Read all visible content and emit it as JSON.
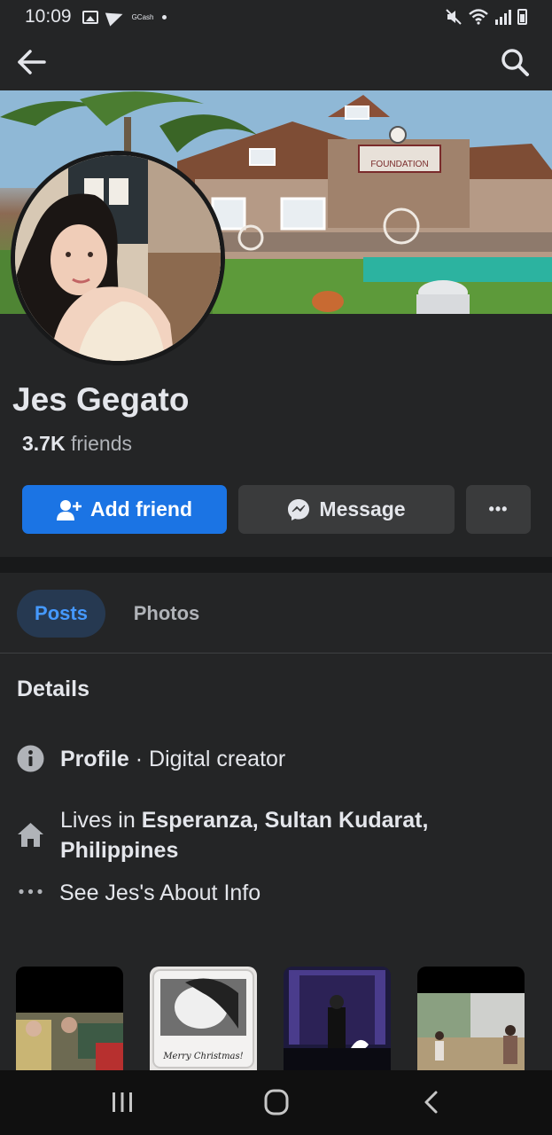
{
  "status_bar": {
    "time": "10:09",
    "gcash_label": "GCash"
  },
  "top_nav": {
    "back_icon": "arrow-left-icon",
    "search_icon": "search-icon"
  },
  "cover": {
    "sign_text": "FOUNDATION"
  },
  "profile": {
    "name": "Jes Gegato",
    "friends_count": "3.7K",
    "friends_label": "friends"
  },
  "actions": {
    "add_friend": "Add friend",
    "message": "Message",
    "more": "•••"
  },
  "tabs": [
    {
      "label": "Posts",
      "active": true
    },
    {
      "label": "Photos",
      "active": false
    }
  ],
  "details": {
    "title": "Details",
    "profile_label": "Profile",
    "profile_sep": " · ",
    "profile_value": "Digital creator",
    "lives_prefix": "Lives in ",
    "lives_location": "Esperanza, Sultan Kudarat, Philippines",
    "about_link": "See Jes's About Info"
  },
  "photos": {
    "thumb2_caption": "Merry Christmas!"
  },
  "colors": {
    "background": "#242526",
    "accent_blue": "#1b74e4",
    "tab_active_bg": "#263951",
    "tab_active_text": "#4599ff",
    "button_gray": "#3a3b3c"
  }
}
